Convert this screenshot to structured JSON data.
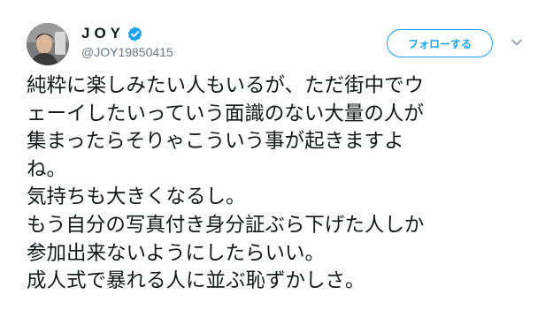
{
  "user": {
    "display_name": "JOY",
    "handle": "@JOY19850415",
    "verified": true
  },
  "follow_button": {
    "label": "フォローする"
  },
  "icons": {
    "verified": "verified-badge-icon",
    "more": "chevron-down-icon"
  },
  "colors": {
    "accent": "#1da1f2",
    "text": "#14171a",
    "secondary_text": "#657786"
  },
  "tweet": {
    "lines": [
      "純粋に楽しみたい人もいるが、ただ街中でウ",
      "ェーイしたいっていう面識のない大量の人が",
      "集まったらそりゃこういう事が起きますよ",
      "ね。",
      "気持ちも大きくなるし。",
      "もう自分の写真付き身分証ぶら下げた人しか",
      "参加出来ないようにしたらいい。",
      "成人式で暴れる人に並ぶ恥ずかしさ。"
    ]
  }
}
